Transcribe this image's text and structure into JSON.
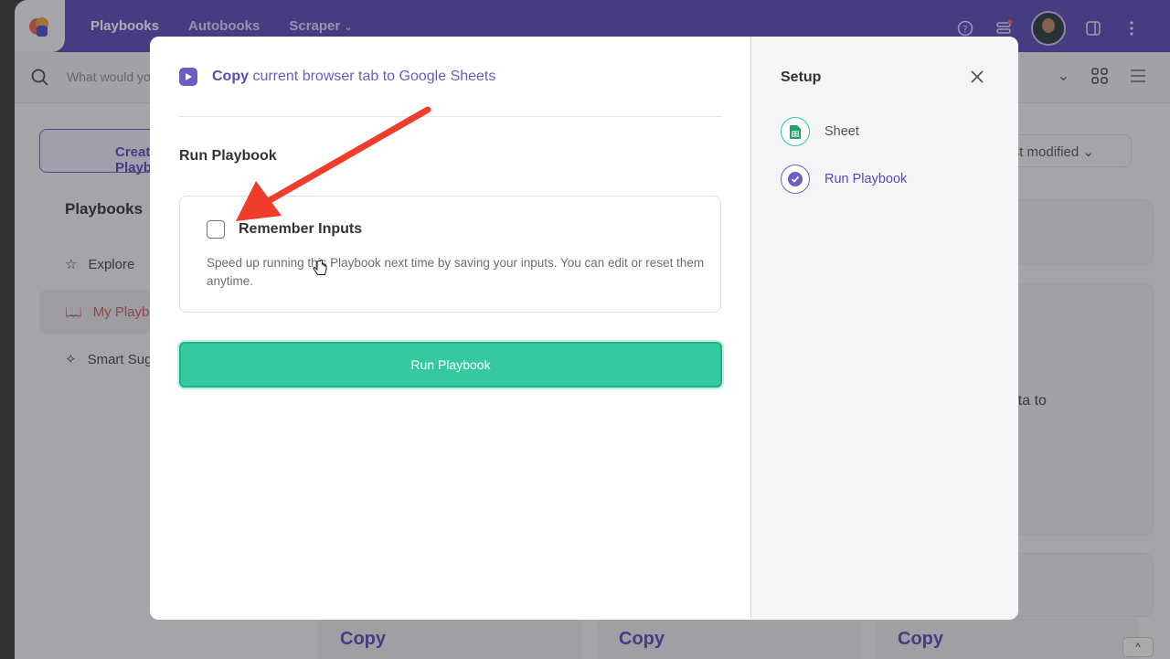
{
  "app": {
    "nav": [
      "Playbooks",
      "Autobooks",
      "Scraper"
    ],
    "search_placeholder": "What would you like to automate?",
    "create_label": "Create Playbook",
    "sidebar_heading": "Playbooks",
    "sidebar_items": [
      "Explore",
      "My Playbooks",
      "Smart Suggestions"
    ],
    "sort_label": "Last modified",
    "bg_card_text": "data to",
    "copy_cards": [
      "Copy",
      "Copy",
      "Copy"
    ],
    "scroll_top": "^"
  },
  "modal": {
    "playbook_verb": "Copy",
    "playbook_rest": "current browser tab to Google Sheets",
    "section_title": "Run Playbook",
    "remember_label": "Remember Inputs",
    "remember_desc": "Speed up running this Playbook next time by saving your inputs. You can edit or reset them anytime.",
    "run_button": "Run Playbook"
  },
  "setup": {
    "title": "Setup",
    "steps": [
      "Sheet",
      "Run Playbook"
    ]
  },
  "colors": {
    "brand": "#5a4ab5",
    "run_button": "#35c9a0",
    "arrow": "#f03c2a"
  }
}
